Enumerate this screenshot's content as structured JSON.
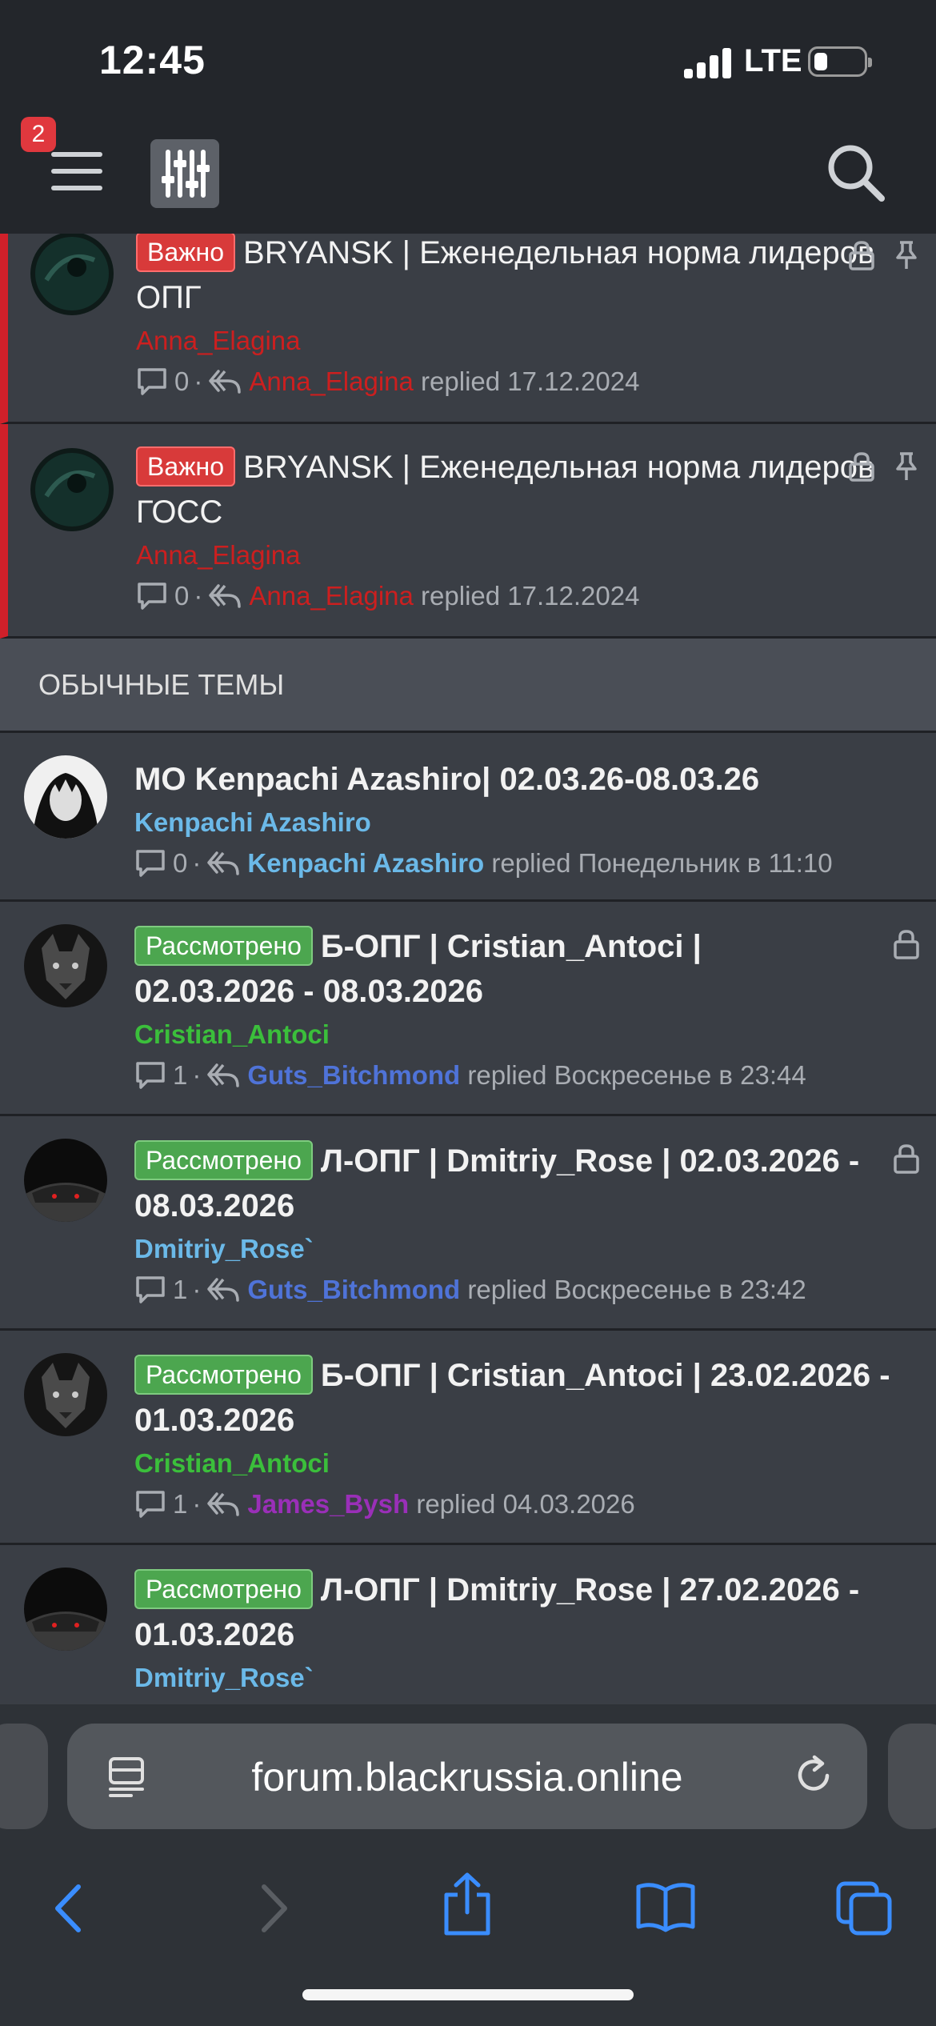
{
  "status": {
    "time": "12:45",
    "network": "LTE"
  },
  "header": {
    "badge": "2"
  },
  "sticky_threads": [
    {
      "prefix": "Важно",
      "title": "BRYANSK | Еженедельная норма лидеров ОПГ",
      "author": "Anna_Elagina",
      "replies": "0",
      "last_poster": "Anna_Elagina",
      "last_text": "replied 17.12.2024"
    },
    {
      "prefix": "Важно",
      "title": "BRYANSK | Еженедельная норма лидеров ГОСС",
      "author": "Anna_Elagina",
      "replies": "0",
      "last_poster": "Anna_Elagina",
      "last_text": "replied 17.12.2024"
    }
  ],
  "section": {
    "label": "ОБЫЧНЫЕ ТЕМЫ"
  },
  "threads": [
    {
      "prefix": "",
      "title": "МО Kenpachi Azashiro| 02.03.26-08.03.26",
      "author": "Kenpachi Azashiro",
      "replies": "0",
      "last_poster": "Kenpachi Azashiro",
      "last_text": "replied Понедельник в 11:10"
    },
    {
      "prefix": "Рассмотрено",
      "title": "Б-ОПГ | Cristian_Antoci | 02.03.2026 - 08.03.2026",
      "author": "Cristian_Antoci",
      "replies": "1",
      "last_poster": "Guts_Bitchmond",
      "last_text": "replied Воскресенье в 23:44"
    },
    {
      "prefix": "Рассмотрено",
      "title": "Л-ОПГ | Dmitriy_Rose | 02.03.2026 - 08.03.2026",
      "author": "Dmitriy_Rose`",
      "replies": "1",
      "last_poster": "Guts_Bitchmond",
      "last_text": "replied Воскресенье в 23:42"
    },
    {
      "prefix": "Рассмотрено",
      "title": "Б-ОПГ | Cristian_Antoci | 23.02.2026 - 01.03.2026",
      "author": "Cristian_Antoci",
      "replies": "1",
      "last_poster": "James_Bysh",
      "last_text": "replied 04.03.2026"
    },
    {
      "prefix": "Рассмотрено",
      "title": "Л-ОПГ | Dmitriy_Rose | 27.02.2026 - 01.03.2026",
      "author": "Dmitriy_Rose`",
      "replies": "",
      "last_poster": "",
      "last_text": ""
    }
  ],
  "browser": {
    "url": "forum.blackrussia.online"
  },
  "colors": {
    "accent": "#d0202a",
    "name_red": "#cc1f1f",
    "name_blue": "#6bb9e8",
    "name_green": "#3bbf3b",
    "name_royal": "#4f73d8",
    "name_purple": "#9a2fb8",
    "browser_blue": "#3a8dff"
  }
}
